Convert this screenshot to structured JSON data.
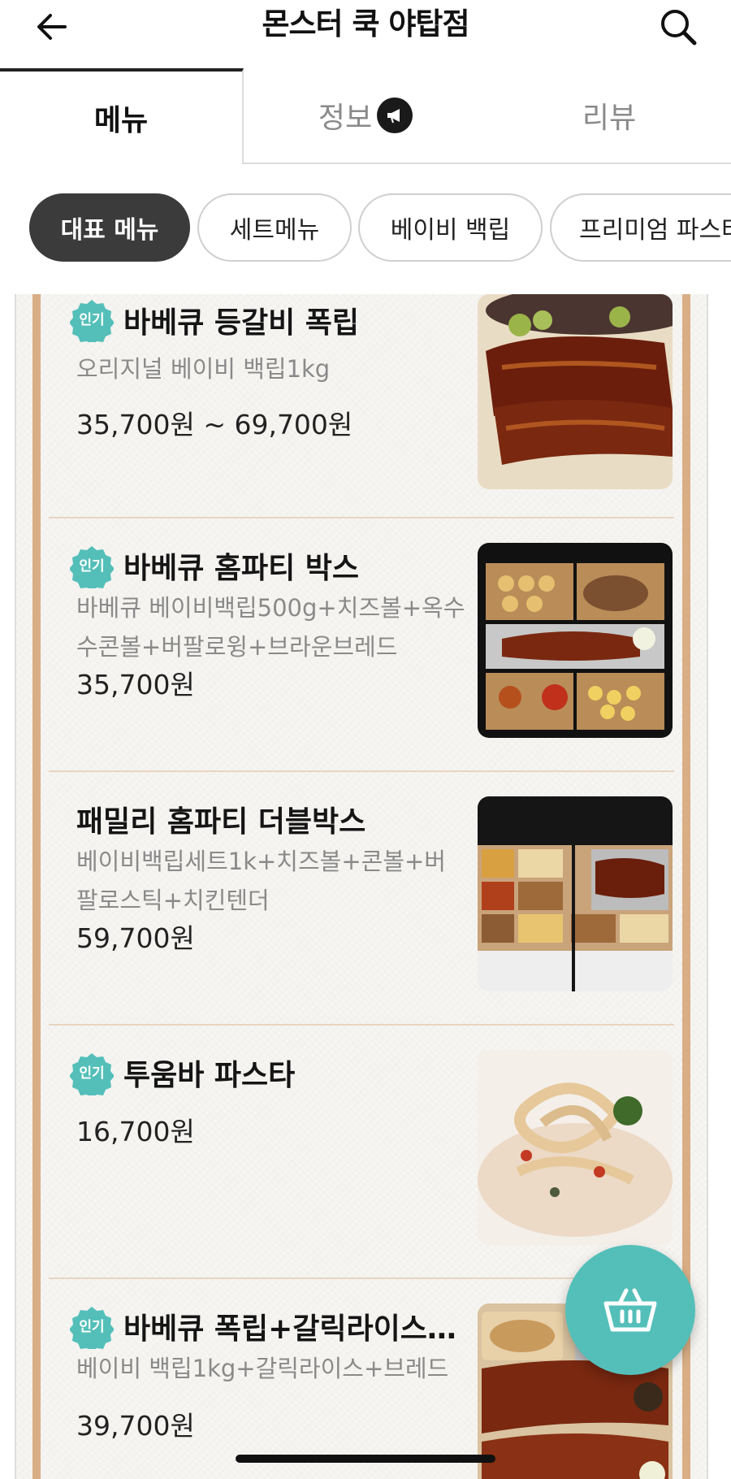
{
  "header": {
    "title": "몬스터 쿡 야탑점"
  },
  "tabs": [
    {
      "label": "메뉴"
    },
    {
      "label": "정보"
    },
    {
      "label": "리뷰"
    }
  ],
  "chips": [
    {
      "label": "대표 메뉴"
    },
    {
      "label": "세트메뉴"
    },
    {
      "label": "베이비 백립"
    },
    {
      "label": "프리미엄 파스타"
    }
  ],
  "popular_badge": "인기",
  "menu": [
    {
      "name": "바베큐 등갈비 폭립",
      "desc": "오리지널 베이비 백립1kg",
      "price": "35,700원 ~ 69,700원",
      "popular": true
    },
    {
      "name": "바베큐 홈파티 박스",
      "desc": "바베큐 베이비백립500g+치즈볼+옥수수콘볼+버팔로윙+브라운브레드",
      "price": "35,700원",
      "popular": true
    },
    {
      "name": "패밀리 홈파티 더블박스",
      "desc": "베이비백립세트1k+치즈볼+콘볼+버팔로스틱+치킨텐더",
      "price": "59,700원",
      "popular": false
    },
    {
      "name": "투움바 파스타",
      "desc": "",
      "price": "16,700원",
      "popular": true
    },
    {
      "name": "바베큐 폭립+갈릭라이스+…",
      "desc": "베이비 백립1kg+갈릭라이스+브레드",
      "price": "39,700원",
      "popular": true
    }
  ],
  "colors": {
    "accent": "#54bfb9",
    "frame": "#d9ae85",
    "chip_active": "#3b3b3b"
  }
}
